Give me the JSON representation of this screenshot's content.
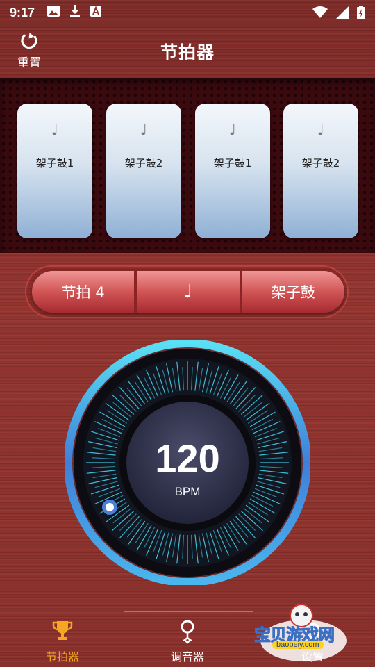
{
  "status_bar": {
    "time": "9:17"
  },
  "header": {
    "reset_label": "重置",
    "title": "节拍器"
  },
  "beats": [
    {
      "note": "♩",
      "label": "架子鼓1"
    },
    {
      "note": "♩",
      "label": "架子鼓2"
    },
    {
      "note": "♩",
      "label": "架子鼓1"
    },
    {
      "note": "♩",
      "label": "架子鼓2"
    }
  ],
  "controls": {
    "beats_label": "节拍 4",
    "note_label": "♩",
    "sound_label": "架子鼓"
  },
  "dial": {
    "bpm": "120",
    "unit": "BPM"
  },
  "bottom_nav": {
    "items": [
      {
        "label": "节拍器",
        "icon": "trophy-icon",
        "active": true
      },
      {
        "label": "调音器",
        "icon": "tuner-pin-icon",
        "active": false
      },
      {
        "label": "设置",
        "icon": "settings-icon",
        "active": false
      }
    ]
  },
  "watermark": {
    "text": "宝贝游戏网",
    "sub": "baobeiy.com"
  },
  "colors": {
    "active_tab": "#f5a623",
    "nav_indicator": "#ff5a2a",
    "dial_ring": "#44d1ec"
  }
}
